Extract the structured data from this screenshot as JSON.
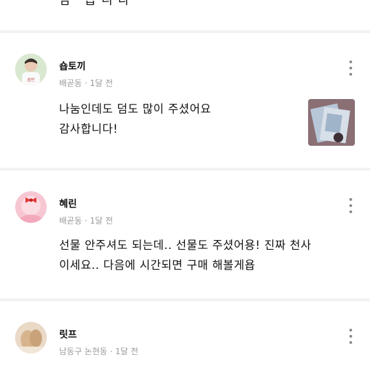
{
  "previous_review": {
    "visible_text": "남 ' 습 니 다"
  },
  "reviews": [
    {
      "nickname": "숍토끼",
      "location": "배곧동",
      "time": "1달 전",
      "text_lines": [
        "나눔인데도 덤도 많이 주셨어요",
        "감사합니다!"
      ],
      "avatar_caption": "숍빈"
    },
    {
      "nickname": "혜린",
      "location": "배곧동",
      "time": "1달 전",
      "text_lines": [
        "선물 안주셔도 되는데.. 선물도 주셨어용! 진짜 천사",
        "이세요.. 다음에 시간되면 구매 해볼게욥"
      ]
    },
    {
      "nickname": "릿프",
      "location": "남동구 논현동",
      "time": "1달 전"
    }
  ],
  "meta_separator": "·",
  "icons": {
    "more": "more-vertical-icon",
    "avatar_default": "user-avatar-icon",
    "avatar_bow": "bow-avatar-icon"
  },
  "colors": {
    "background": "#f2f2f2",
    "card": "#ffffff",
    "meta_text": "#9a9a9a",
    "avatar_pink": "#f6b3c3",
    "bow_red": "#e23a3a"
  }
}
